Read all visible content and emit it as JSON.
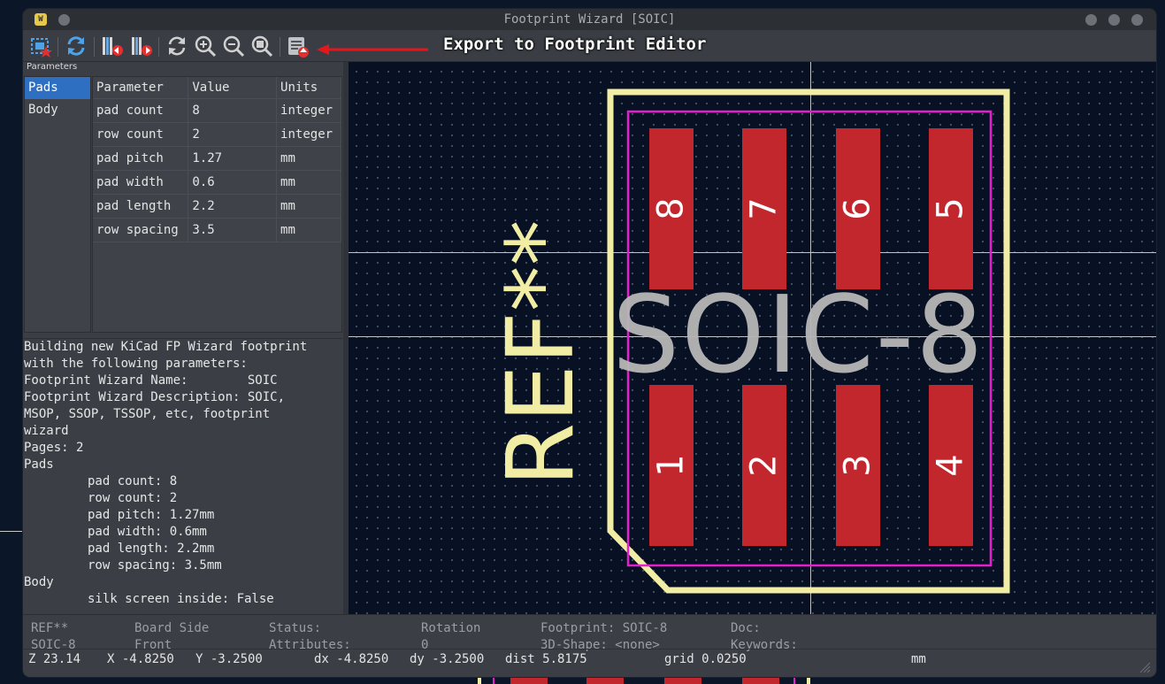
{
  "window": {
    "title": "Footprint Wizard [SOIC]"
  },
  "toolbar": {
    "tools": [
      {
        "name": "select-wizard",
        "icon": "footprint-wizard-icon"
      },
      {
        "name": "reset-params",
        "icon": "refresh-icon"
      },
      {
        "name": "prev-page",
        "icon": "library-prev-icon"
      },
      {
        "name": "next-page",
        "icon": "library-next-icon"
      },
      {
        "name": "redraw",
        "icon": "redraw-icon"
      },
      {
        "name": "zoom-in",
        "icon": "zoom-in-icon"
      },
      {
        "name": "zoom-out",
        "icon": "zoom-out-icon"
      },
      {
        "name": "zoom-fit",
        "icon": "zoom-fit-icon"
      },
      {
        "name": "export",
        "icon": "export-footprint-icon"
      }
    ],
    "annotation": "Export to Footprint Editor",
    "annotation_color": "#e3171c"
  },
  "parameters": {
    "label": "Parameters",
    "pages": [
      "Pads",
      "Body"
    ],
    "selected_page": "Pads",
    "columns": [
      "Parameter",
      "Value",
      "Units"
    ],
    "rows": [
      [
        "pad count",
        "8",
        "integer"
      ],
      [
        "row count",
        "2",
        "integer"
      ],
      [
        "pad pitch",
        "1.27",
        "mm"
      ],
      [
        "pad width",
        "0.6",
        "mm"
      ],
      [
        "pad length",
        "2.2",
        "mm"
      ],
      [
        "row spacing",
        "3.5",
        "mm"
      ]
    ]
  },
  "description": {
    "lines": [
      "Building new KiCad FP Wizard footprint",
      "with the following parameters:",
      "Footprint Wizard Name:        SOIC",
      "Footprint Wizard Description: SOIC,",
      "MSOP, SSOP, TSSOP, etc, footprint",
      "wizard",
      "Pages: 2",
      "Pads"
    ],
    "indented_lines": [
      "pad count: 8",
      "row count: 2",
      "pad pitch: 1.27mm",
      "pad width: 0.6mm",
      "pad length: 2.2mm",
      "row spacing: 3.5mm"
    ],
    "body_heading": "Body",
    "body_lines": [
      "silk screen inside: False"
    ]
  },
  "preview": {
    "reference": "REF**",
    "value": "SOIC-8",
    "top_pads": [
      "8",
      "7",
      "6",
      "5"
    ],
    "bottom_pads": [
      "1",
      "2",
      "3",
      "4"
    ],
    "colors": {
      "pad": "#c1272d",
      "silk": "#f2eda4",
      "courtyard": "#e51fd0",
      "fab": "#b7b7b7",
      "background": "#071123"
    }
  },
  "status": {
    "ref": "REF**",
    "value": "SOIC-8",
    "board_side_label": "Board Side",
    "board_side": "Front",
    "status_label": "Status:",
    "attributes_label": "Attributes:",
    "rotation_label": "Rotation",
    "rotation": "0",
    "footprint": "Footprint: SOIC-8",
    "shape3d": "3D-Shape: <none>",
    "doc": "Doc:",
    "keywords": "Keywords:",
    "zoom": "Z 23.14",
    "x": "X -4.8250",
    "y": "Y -3.2500",
    "dx": "dx -4.8250",
    "dy": "dy -3.2500",
    "dist": "dist 5.8175",
    "grid": "grid 0.0250",
    "units": "mm"
  }
}
